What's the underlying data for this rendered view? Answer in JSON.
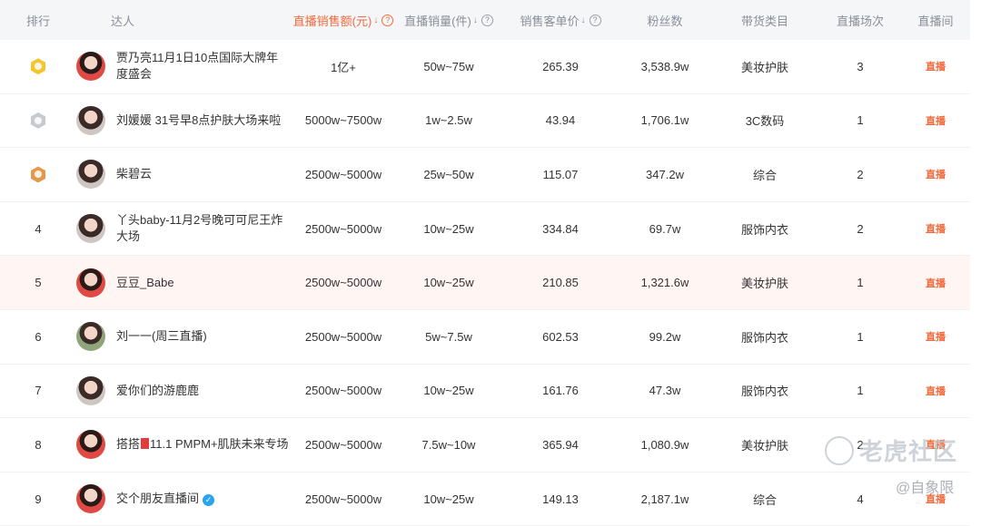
{
  "header": {
    "rank": "排行",
    "talent": "达人",
    "sales": "直播销售额(元)",
    "volume": "直播销量(件)",
    "price": "销售客单价",
    "fans": "粉丝数",
    "category": "带货类目",
    "sessions": "直播场次",
    "room": "直播间"
  },
  "rows": [
    {
      "rank": "",
      "medal": "gold",
      "name": "贾乃亮11月1日10点国际大牌年度盛会",
      "sales": "1亿+",
      "volume": "50w~75w",
      "price": "265.39",
      "fans": "3,538.9w",
      "category": "美妆护肤",
      "sessions": "3"
    },
    {
      "rank": "",
      "medal": "silver",
      "name": "刘媛媛 31号早8点护肤大场来啦",
      "sales": "5000w~7500w",
      "volume": "1w~2.5w",
      "price": "43.94",
      "fans": "1,706.1w",
      "category": "3C数码",
      "sessions": "1"
    },
    {
      "rank": "",
      "medal": "bronze",
      "name": "柴碧云",
      "sales": "2500w~5000w",
      "volume": "25w~50w",
      "price": "115.07",
      "fans": "347.2w",
      "category": "综合",
      "sessions": "2"
    },
    {
      "rank": "4",
      "name": "丫头baby-11月2号晚可可尼王炸大场",
      "sales": "2500w~5000w",
      "volume": "10w~25w",
      "price": "334.84",
      "fans": "69.7w",
      "category": "服饰内衣",
      "sessions": "2"
    },
    {
      "rank": "5",
      "name": "豆豆_Babe",
      "sales": "2500w~5000w",
      "volume": "10w~25w",
      "price": "210.85",
      "fans": "1,321.6w",
      "category": "美妆护肤",
      "sessions": "1"
    },
    {
      "rank": "6",
      "name": "刘一一(周三直播)",
      "sales": "2500w~5000w",
      "volume": "5w~7.5w",
      "price": "602.53",
      "fans": "99.2w",
      "category": "服饰内衣",
      "sessions": "1"
    },
    {
      "rank": "7",
      "name": "爱你们的游鹿鹿",
      "sales": "2500w~5000w",
      "volume": "10w~25w",
      "price": "161.76",
      "fans": "47.3w",
      "category": "服饰内衣",
      "sessions": "1"
    },
    {
      "rank": "8",
      "name_pre": "搭搭",
      "name_post": "11.1 PMPM+肌肤未来专场",
      "sales": "2500w~5000w",
      "volume": "7.5w~10w",
      "price": "365.94",
      "fans": "1,080.9w",
      "category": "美妆护肤",
      "sessions": "2"
    },
    {
      "rank": "9",
      "name": "交个朋友直播间",
      "sales": "2500w~5000w",
      "volume": "10w~25w",
      "price": "149.13",
      "fans": "2,187.1w",
      "category": "综合",
      "sessions": "4"
    }
  ],
  "icons": {
    "room": "live-room-icon",
    "help": "question-circle-icon",
    "sort": "sort-down-icon",
    "verified": "verified-badge-icon"
  },
  "room_glyph": "直播",
  "watermark": {
    "primary": "老虎社区",
    "secondary": "@自象限"
  },
  "colors": {
    "accent": "#f2693b",
    "header_bg": "#f5f6f8",
    "highlight_row": "#fff6f4",
    "verified": "#2aa3f0"
  }
}
